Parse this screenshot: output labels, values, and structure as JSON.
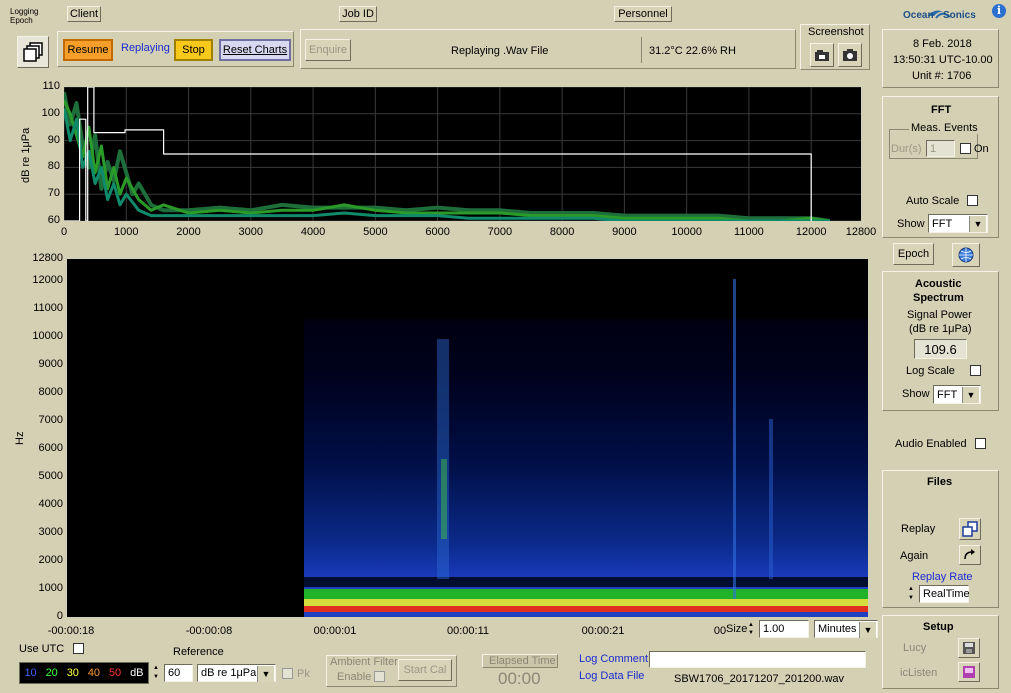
{
  "header": {
    "logging_label": "Logging",
    "epoch_label": "Epoch",
    "client": "Client",
    "job_id": "Job ID",
    "personnel": "Personnel",
    "logo_left": "Ocean",
    "logo_right": "Sonics",
    "info_icon": "info-icon"
  },
  "toolbar": {
    "resume": "Resume",
    "replaying": "Replaying",
    "stop": "Stop",
    "reset_charts": "Reset Charts",
    "enquire": "Enquire",
    "status": "Replaying .Wav File",
    "env": "31.2°C 22.6% RH",
    "screenshot": "Screenshot"
  },
  "clock": {
    "date": "8 Feb. 2018",
    "time": "13:50:31 UTC-10.00",
    "unit": "Unit #: 1706"
  },
  "fft_panel": {
    "title": "FFT",
    "meas_events": "Meas. Events",
    "dur_label": "Dur(s)",
    "dur_value": "1",
    "on_label": "On",
    "auto_scale": "Auto Scale",
    "show_label": "Show",
    "show_value": "FFT"
  },
  "epoch_button": "Epoch",
  "acoustic": {
    "title1": "Acoustic",
    "title2": "Spectrum",
    "signal_power": "Signal Power",
    "units": "(dB re 1μPa)",
    "value": "109.6",
    "log_scale": "Log Scale",
    "show_label": "Show",
    "show_value": "FFT"
  },
  "audio_enabled": "Audio Enabled",
  "files": {
    "title": "Files",
    "replay": "Replay",
    "again": "Again",
    "replay_rate": "Replay Rate",
    "rate_value": "RealTime"
  },
  "setup": {
    "title": "Setup",
    "lucy": "Lucy",
    "iclisten": "icListen"
  },
  "spectrum_chart": {
    "ylabel": "dB re 1μPa",
    "yticks": [
      "110",
      "100",
      "90",
      "80",
      "70",
      "60"
    ],
    "xticks": [
      "0",
      "1000",
      "2000",
      "3000",
      "4000",
      "5000",
      "6000",
      "7000",
      "8000",
      "9000",
      "10000",
      "11000",
      "12000",
      "12800"
    ]
  },
  "spectrogram": {
    "ylabel": "Hz",
    "yticks": [
      "12800",
      "12000",
      "11000",
      "10000",
      "9000",
      "8000",
      "7000",
      "6000",
      "5000",
      "4000",
      "3000",
      "2000",
      "1000",
      "0"
    ],
    "xticks": [
      "-00:00:18",
      "-00:00:08",
      "00:00:01",
      "00:00:11",
      "00:00:21",
      "00"
    ]
  },
  "size": {
    "label": "Size",
    "value": "1.00",
    "unit": "Minutes"
  },
  "bottom": {
    "use_utc": "Use UTC",
    "reference": "Reference",
    "scale": [
      "10",
      "20",
      "30",
      "40",
      "50",
      "dB"
    ],
    "scale_colors": [
      "#4060ff",
      "#40ff40",
      "#ffff40",
      "#ff9a30",
      "#ff3030",
      "#ffffff"
    ],
    "ref_value": "60",
    "ref_unit": "dB re 1μPa",
    "pk": "Pk",
    "ambient_filter": "Ambient Filter",
    "enable": "Enable",
    "start_cal": "Start Cal",
    "elapsed_time": "Elapsed Time",
    "elapsed_value": "00:00",
    "log_comment": "Log Comment",
    "log_data_file": "Log Data File",
    "file_name": "SBW1706_20171207_201200.wav"
  },
  "chart_data": [
    {
      "type": "line",
      "ylabel": "dB re 1μPa",
      "xlim": [
        0,
        12800
      ],
      "ylim": [
        60,
        110
      ],
      "grid": true,
      "series": [
        {
          "values": [
            [
              0,
              108
            ],
            [
              100,
              96
            ],
            [
              200,
              104
            ],
            [
              300,
              88
            ],
            [
              400,
              80
            ],
            [
              500,
              92
            ],
            [
              600,
              72
            ],
            [
              700,
              82
            ],
            [
              800,
              75
            ],
            [
              900,
              86
            ],
            [
              1000,
              78
            ],
            [
              1100,
              70
            ],
            [
              1200,
              74
            ],
            [
              1400,
              66
            ],
            [
              1600,
              64
            ],
            [
              2000,
              64
            ],
            [
              2500,
              65
            ],
            [
              3000,
              64
            ],
            [
              3500,
              66
            ],
            [
              4000,
              65
            ],
            [
              4500,
              65
            ],
            [
              5000,
              65
            ],
            [
              5500,
              64
            ],
            [
              6000,
              65
            ],
            [
              6500,
              64
            ],
            [
              7000,
              64
            ],
            [
              7500,
              63
            ],
            [
              8000,
              63
            ],
            [
              8500,
              63
            ],
            [
              9000,
              62
            ],
            [
              9500,
              62
            ],
            [
              10000,
              62
            ],
            [
              10500,
              62
            ],
            [
              11000,
              61
            ],
            [
              11500,
              61
            ],
            [
              12000,
              61
            ],
            [
              12300,
              60
            ]
          ]
        },
        {
          "values": [
            [
              0,
              105
            ],
            [
              100,
              100
            ],
            [
              200,
              92
            ],
            [
              300,
              84
            ],
            [
              400,
              95
            ],
            [
              500,
              78
            ],
            [
              600,
              88
            ],
            [
              700,
              72
            ],
            [
              800,
              80
            ],
            [
              900,
              70
            ],
            [
              1000,
              76
            ],
            [
              1200,
              68
            ],
            [
              1400,
              64
            ],
            [
              1600,
              66
            ],
            [
              2000,
              63
            ],
            [
              2500,
              64
            ],
            [
              3000,
              63
            ],
            [
              3500,
              64
            ],
            [
              4000,
              64
            ],
            [
              4500,
              66
            ],
            [
              5000,
              64
            ],
            [
              5500,
              63
            ],
            [
              6000,
              63
            ],
            [
              6500,
              63
            ],
            [
              7000,
              63
            ],
            [
              7500,
              62
            ],
            [
              8000,
              62
            ],
            [
              8500,
              62
            ],
            [
              9000,
              61
            ],
            [
              9500,
              61
            ],
            [
              10000,
              61
            ],
            [
              10500,
              61
            ],
            [
              11000,
              60
            ],
            [
              11500,
              60
            ],
            [
              12000,
              61
            ],
            [
              12300,
              60
            ]
          ]
        },
        {
          "values": [
            [
              0,
              102
            ],
            [
              100,
              90
            ],
            [
              200,
              98
            ],
            [
              300,
              80
            ],
            [
              400,
              86
            ],
            [
              500,
              74
            ],
            [
              600,
              80
            ],
            [
              700,
              68
            ],
            [
              800,
              74
            ],
            [
              900,
              66
            ],
            [
              1000,
              70
            ],
            [
              1200,
              64
            ],
            [
              1400,
              62
            ],
            [
              1600,
              62
            ],
            [
              2000,
              62
            ],
            [
              2500,
              62
            ],
            [
              3000,
              62
            ],
            [
              3500,
              62
            ],
            [
              4000,
              62
            ],
            [
              4500,
              63
            ],
            [
              5000,
              62
            ],
            [
              5500,
              62
            ],
            [
              6000,
              62
            ],
            [
              6500,
              61
            ],
            [
              7000,
              61
            ],
            [
              7500,
              61
            ],
            [
              8000,
              61
            ],
            [
              8500,
              61
            ],
            [
              9000,
              60
            ],
            [
              9500,
              60
            ],
            [
              10000,
              60
            ],
            [
              10500,
              60
            ],
            [
              11000,
              60
            ],
            [
              11500,
              60
            ],
            [
              12000,
              60
            ],
            [
              12300,
              60
            ]
          ]
        },
        {
          "values": [
            [
              0,
              60
            ],
            [
              250,
              60
            ],
            [
              250,
              98
            ],
            [
              350,
              98
            ],
            [
              350,
              60
            ],
            [
              380,
              60
            ],
            [
              380,
              110
            ],
            [
              480,
              110
            ],
            [
              480,
              93
            ],
            [
              980,
              93
            ],
            [
              980,
              94
            ],
            [
              1600,
              94
            ],
            [
              1600,
              85
            ],
            [
              12000,
              85
            ],
            [
              12000,
              60
            ]
          ]
        }
      ]
    },
    {
      "type": "heatmap",
      "ylabel": "Hz",
      "ylim": [
        0,
        12800
      ],
      "x_ticks": [
        "-00:00:18",
        "-00:00:08",
        "00:00:01",
        "00:00:11",
        "00:00:21",
        "00"
      ],
      "color_scale_db": [
        10,
        20,
        30,
        40,
        50
      ]
    }
  ]
}
